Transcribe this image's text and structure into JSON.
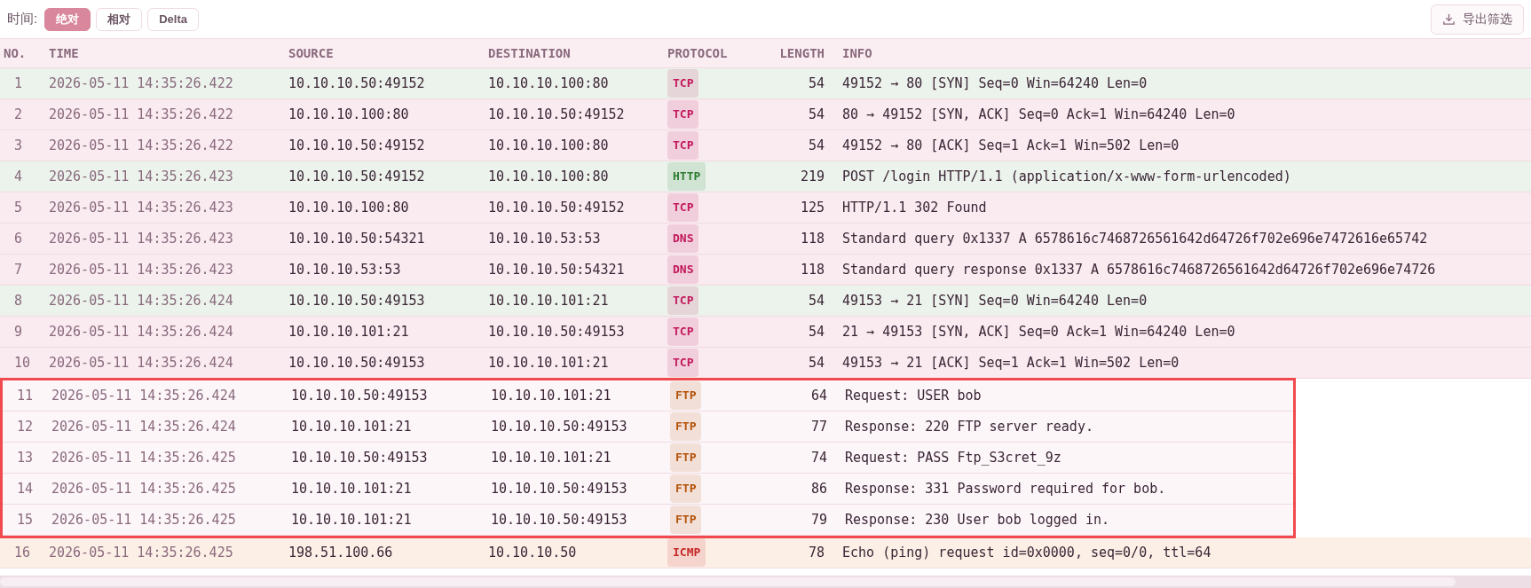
{
  "toolbar": {
    "label": "时间:",
    "modes": [
      {
        "label": "绝对",
        "selected": true
      },
      {
        "label": "相对",
        "selected": false
      },
      {
        "label": "Delta",
        "selected": false
      }
    ],
    "export_button": "导出筛选"
  },
  "table": {
    "columns": [
      "NO.",
      "TIME",
      "SOURCE",
      "DESTINATION",
      "PROTOCOL",
      "LENGTH",
      "INFO"
    ],
    "rows": [
      {
        "no": "1",
        "time": "2026-05-11 14:35:26.422",
        "source": "10.10.10.50:49152",
        "destination": "10.10.10.100:80",
        "protocol": {
          "label": "TCP",
          "color": "#c2185b"
        },
        "length": "54",
        "info": "49152 → 80 [SYN] Seq=0 Win=64240 Len=0",
        "color": "#ebf3ec",
        "boxed": false
      },
      {
        "no": "2",
        "time": "2026-05-11 14:35:26.422",
        "source": "10.10.10.100:80",
        "destination": "10.10.10.50:49152",
        "protocol": {
          "label": "TCP",
          "color": "#c2185b"
        },
        "length": "54",
        "info": "80 → 49152 [SYN, ACK] Seq=0 Ack=1 Win=64240 Len=0",
        "color": "#f9ebf0",
        "boxed": false
      },
      {
        "no": "3",
        "time": "2026-05-11 14:35:26.422",
        "source": "10.10.10.50:49152",
        "destination": "10.10.10.100:80",
        "protocol": {
          "label": "TCP",
          "color": "#c2185b"
        },
        "length": "54",
        "info": "49152 → 80 [ACK] Seq=1 Ack=1 Win=502 Len=0",
        "color": "#f9ebf0",
        "boxed": false
      },
      {
        "no": "4",
        "time": "2026-05-11 14:35:26.423",
        "source": "10.10.10.50:49152",
        "destination": "10.10.10.100:80",
        "protocol": {
          "label": "HTTP",
          "color": "#2e7d32"
        },
        "length": "219",
        "info": "POST /login HTTP/1.1 (application/x-www-form-urlencoded)",
        "color": "#ebf3ec",
        "boxed": false
      },
      {
        "no": "5",
        "time": "2026-05-11 14:35:26.423",
        "source": "10.10.10.100:80",
        "destination": "10.10.10.50:49152",
        "protocol": {
          "label": "TCP",
          "color": "#c2185b"
        },
        "length": "125",
        "info": "HTTP/1.1 302 Found",
        "color": "#f9ebf0",
        "boxed": false
      },
      {
        "no": "6",
        "time": "2026-05-11 14:35:26.423",
        "source": "10.10.10.50:54321",
        "destination": "10.10.10.53:53",
        "protocol": {
          "label": "DNS",
          "color": "#c2185b"
        },
        "length": "118",
        "info": "Standard query 0x1337 A 6578616c7468726561642d64726f702e696e7472616e65742",
        "color": "#f9ebf0",
        "boxed": false
      },
      {
        "no": "7",
        "time": "2026-05-11 14:35:26.423",
        "source": "10.10.10.53:53",
        "destination": "10.10.10.50:54321",
        "protocol": {
          "label": "DNS",
          "color": "#c2185b"
        },
        "length": "118",
        "info": "Standard query response 0x1337 A 6578616c7468726561642d64726f702e696e74726",
        "color": "#f9ebf0",
        "boxed": false
      },
      {
        "no": "8",
        "time": "2026-05-11 14:35:26.424",
        "source": "10.10.10.50:49153",
        "destination": "10.10.10.101:21",
        "protocol": {
          "label": "TCP",
          "color": "#c2185b"
        },
        "length": "54",
        "info": "49153 → 21 [SYN] Seq=0 Win=64240 Len=0",
        "color": "#ebf3ec",
        "boxed": false
      },
      {
        "no": "9",
        "time": "2026-05-11 14:35:26.424",
        "source": "10.10.10.101:21",
        "destination": "10.10.10.50:49153",
        "protocol": {
          "label": "TCP",
          "color": "#c2185b"
        },
        "length": "54",
        "info": "21 → 49153 [SYN, ACK] Seq=0 Ack=1 Win=64240 Len=0",
        "color": "#f9ebf0",
        "boxed": false
      },
      {
        "no": "10",
        "time": "2026-05-11 14:35:26.424",
        "source": "10.10.10.50:49153",
        "destination": "10.10.10.101:21",
        "protocol": {
          "label": "TCP",
          "color": "#c2185b"
        },
        "length": "54",
        "info": "49153 → 21 [ACK] Seq=1 Ack=1 Win=502 Len=0",
        "color": "#f9ebf0",
        "boxed": false
      },
      {
        "no": "11",
        "time": "2026-05-11 14:35:26.424",
        "source": "10.10.10.50:49153",
        "destination": "10.10.10.101:21",
        "protocol": {
          "label": "FTP",
          "color": "#b45309"
        },
        "length": "64",
        "info": "Request: USER bob",
        "color": "#fcf6f9",
        "boxed": true
      },
      {
        "no": "12",
        "time": "2026-05-11 14:35:26.424",
        "source": "10.10.10.101:21",
        "destination": "10.10.10.50:49153",
        "protocol": {
          "label": "FTP",
          "color": "#b45309"
        },
        "length": "77",
        "info": "Response: 220 FTP server ready.",
        "color": "#fcf6f9",
        "boxed": true
      },
      {
        "no": "13",
        "time": "2026-05-11 14:35:26.425",
        "source": "10.10.10.50:49153",
        "destination": "10.10.10.101:21",
        "protocol": {
          "label": "FTP",
          "color": "#b45309"
        },
        "length": "74",
        "info": "Request: PASS Ftp_S3cret_9z",
        "color": "#fcf6f9",
        "boxed": true
      },
      {
        "no": "14",
        "time": "2026-05-11 14:35:26.425",
        "source": "10.10.10.101:21",
        "destination": "10.10.10.50:49153",
        "protocol": {
          "label": "FTP",
          "color": "#b45309"
        },
        "length": "86",
        "info": "Response: 331 Password required for bob.",
        "color": "#fcf6f9",
        "boxed": true
      },
      {
        "no": "15",
        "time": "2026-05-11 14:35:26.425",
        "source": "10.10.10.101:21",
        "destination": "10.10.10.50:49153",
        "protocol": {
          "label": "FTP",
          "color": "#b45309"
        },
        "length": "79",
        "info": "Response: 230 User bob logged in.",
        "color": "#fcf6f9",
        "boxed": true
      },
      {
        "no": "16",
        "time": "2026-05-11 14:35:26.425",
        "source": "198.51.100.66",
        "destination": "10.10.10.50",
        "protocol": {
          "label": "ICMP",
          "color": "#c62828"
        },
        "length": "78",
        "info": "Echo (ping) request id=0x0000, seq=0/0, ttl=64",
        "color": "#fcefe6",
        "boxed": false
      }
    ]
  }
}
